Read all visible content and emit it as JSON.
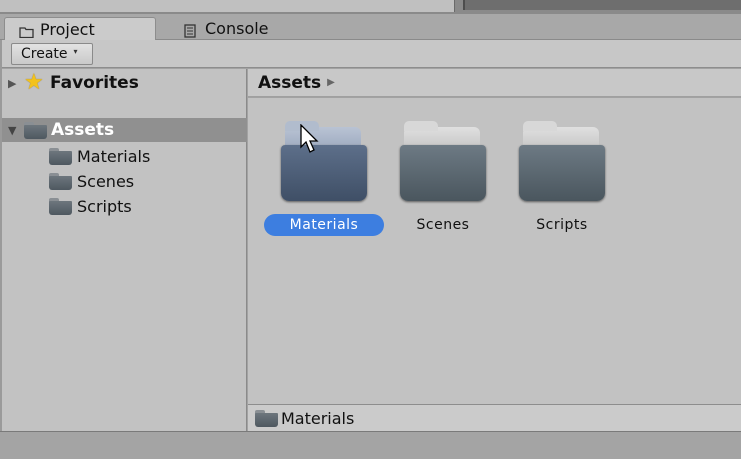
{
  "tabs": [
    {
      "label": "Project",
      "icon": "folder-icon",
      "active": true
    },
    {
      "label": "Console",
      "icon": "console-icon",
      "active": false
    }
  ],
  "toolbar": {
    "create_label": "Create",
    "create_caret": "▾"
  },
  "tree": {
    "favorites": {
      "label": "Favorites",
      "icon": "star-icon",
      "collapsed_glyph": "▶"
    },
    "assets": {
      "label": "Assets",
      "icon": "folder-icon",
      "expanded_glyph": "▼"
    },
    "children": [
      {
        "label": "Materials"
      },
      {
        "label": "Scenes"
      },
      {
        "label": "Scripts"
      }
    ]
  },
  "breadcrumb": {
    "label": "Assets",
    "arrow": "▶"
  },
  "grid": [
    {
      "label": "Materials",
      "selected": true
    },
    {
      "label": "Scenes",
      "selected": false
    },
    {
      "label": "Scripts",
      "selected": false
    }
  ],
  "path_bar": {
    "label": "Materials"
  },
  "colors": {
    "selection": "#3d7ee0",
    "panel": "#c2c2c2",
    "tree_selected": "#909090"
  }
}
